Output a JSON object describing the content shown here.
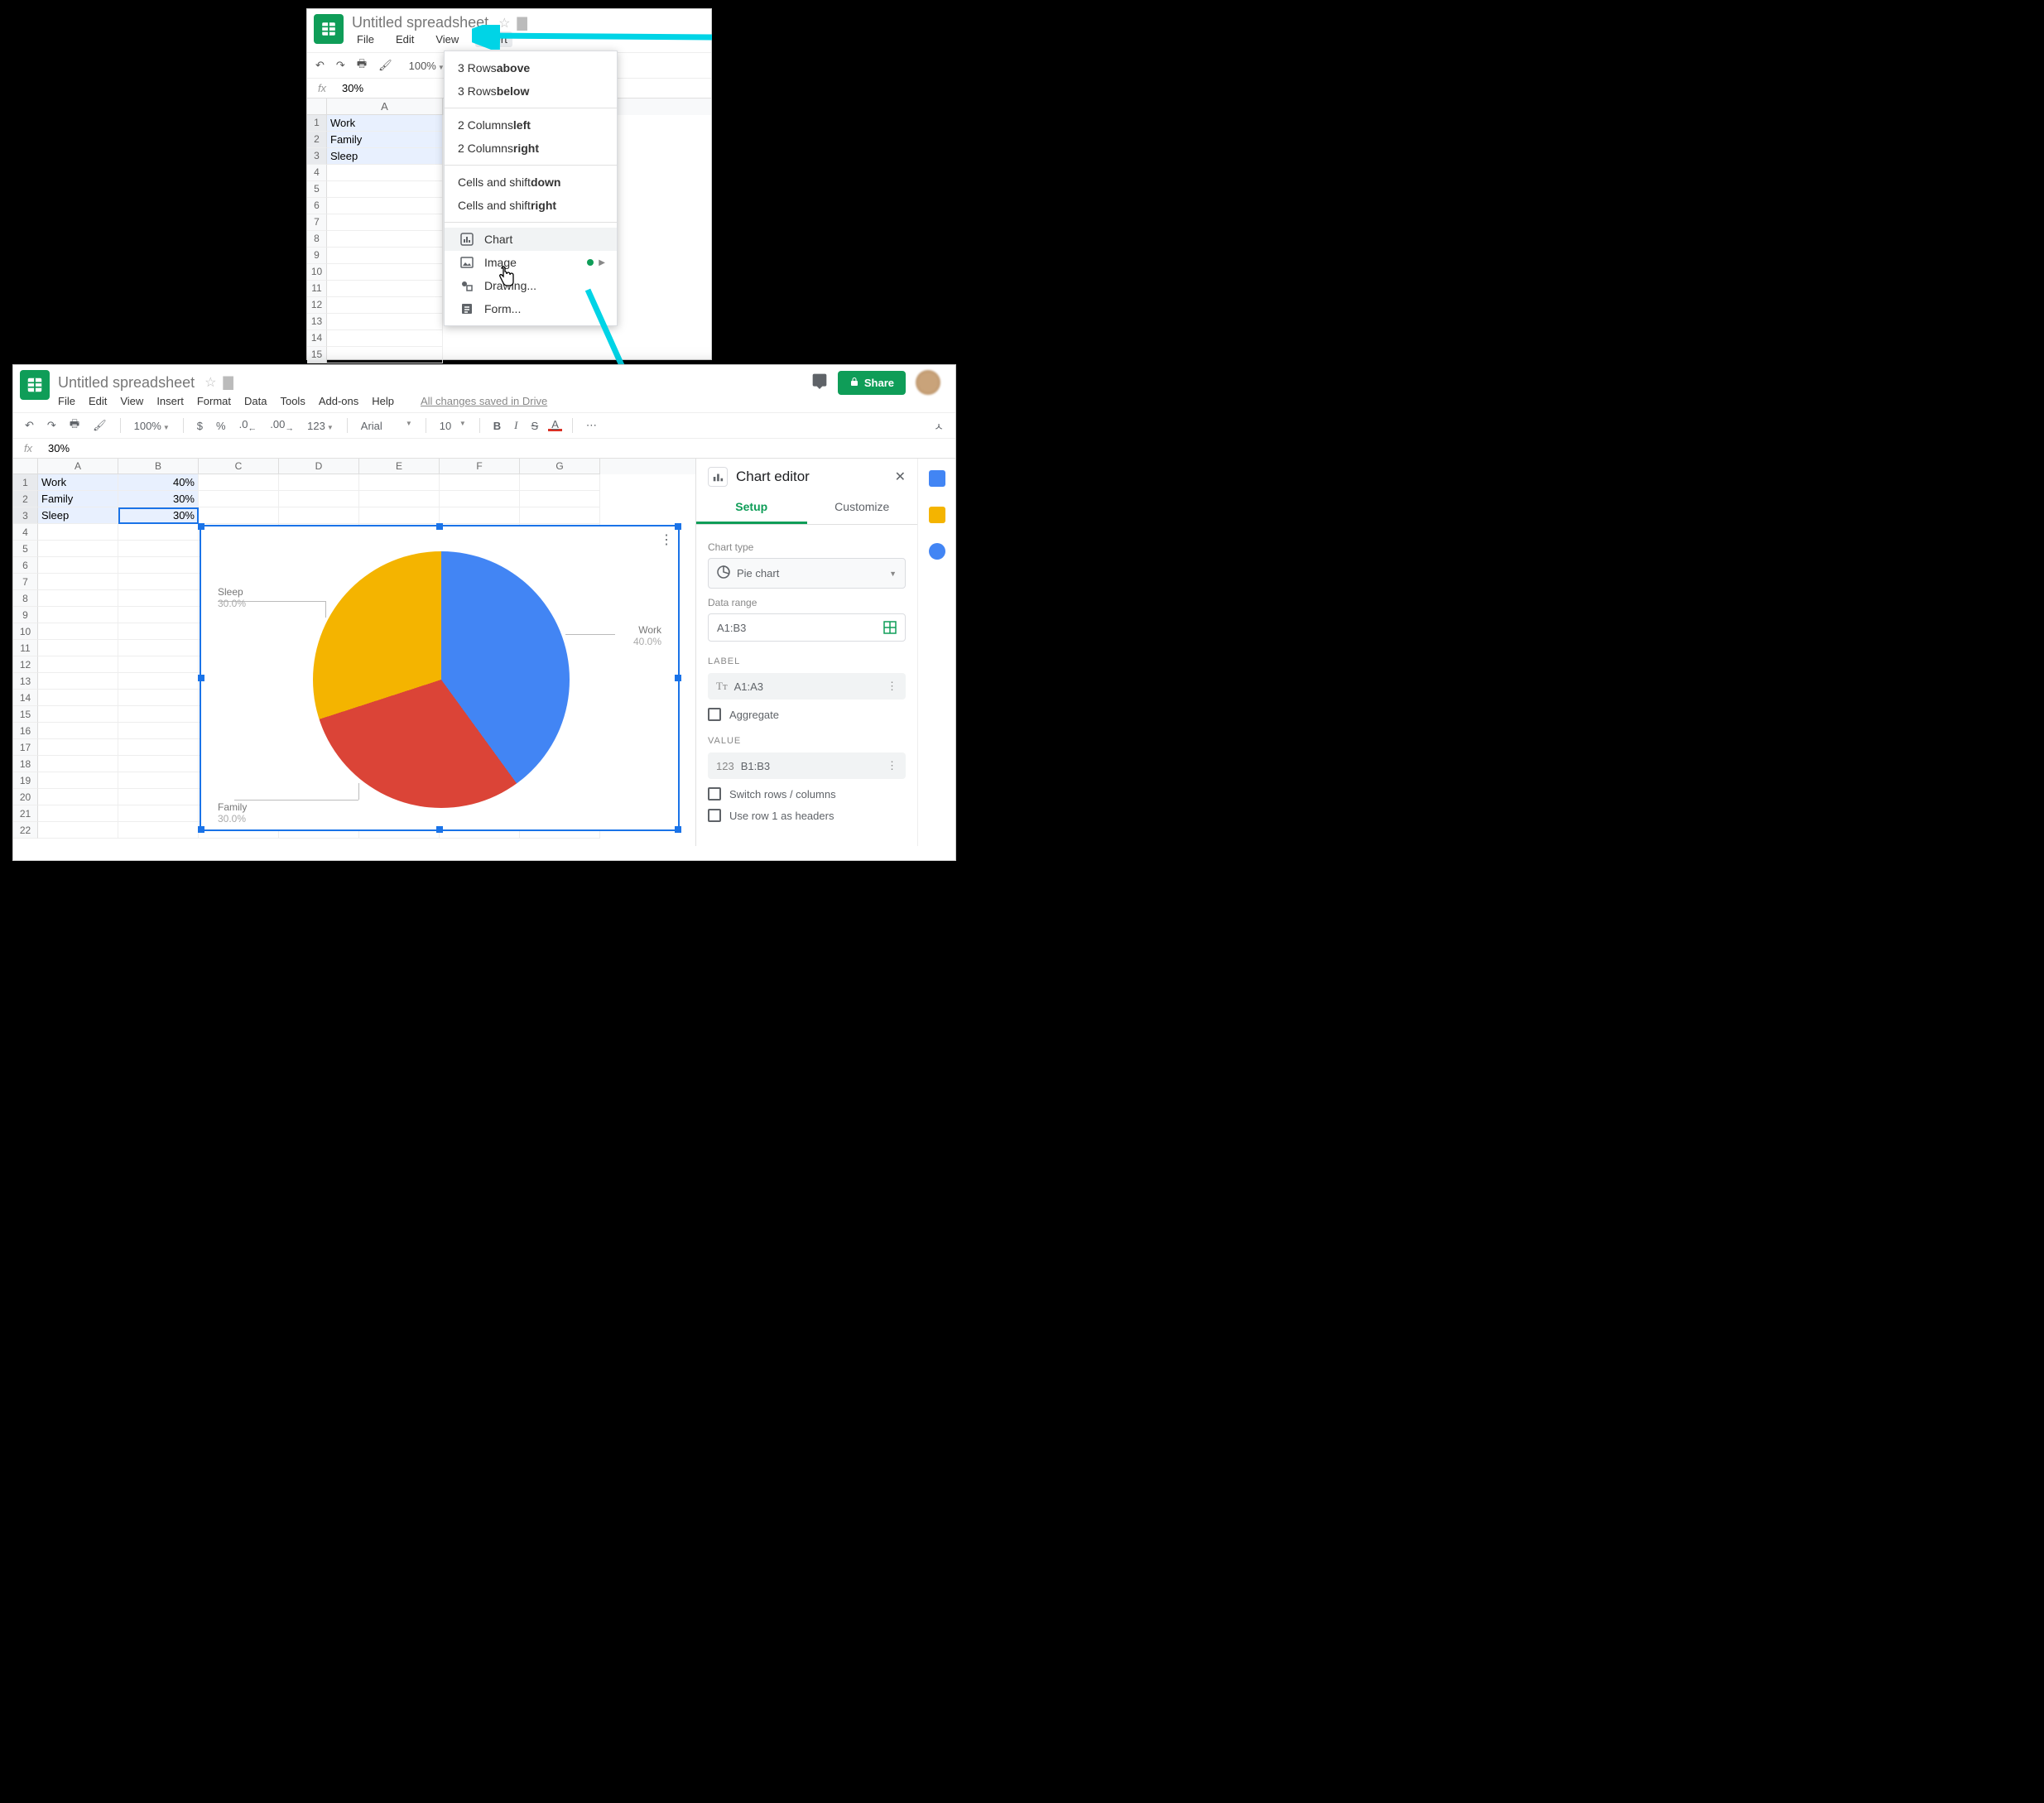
{
  "top": {
    "title": "Untitled spreadsheet",
    "menus": [
      "File",
      "Edit",
      "View",
      "Insert"
    ],
    "active_menu": "Insert",
    "zoom": "100%",
    "fx_value": "30%",
    "col_headers": [
      "A"
    ],
    "rows": [
      {
        "n": "1",
        "a": "Work"
      },
      {
        "n": "2",
        "a": "Family"
      },
      {
        "n": "3",
        "a": "Sleep"
      },
      {
        "n": "4",
        "a": ""
      },
      {
        "n": "5",
        "a": ""
      },
      {
        "n": "6",
        "a": ""
      },
      {
        "n": "7",
        "a": ""
      },
      {
        "n": "8",
        "a": ""
      },
      {
        "n": "9",
        "a": ""
      },
      {
        "n": "10",
        "a": ""
      },
      {
        "n": "11",
        "a": ""
      },
      {
        "n": "12",
        "a": ""
      },
      {
        "n": "13",
        "a": ""
      },
      {
        "n": "14",
        "a": ""
      },
      {
        "n": "15",
        "a": ""
      }
    ],
    "dropdown": {
      "rows_above": {
        "pre": "3 Rows ",
        "b": "above"
      },
      "rows_below": {
        "pre": "3 Rows ",
        "b": "below"
      },
      "cols_left": {
        "pre": "2 Columns ",
        "b": "left"
      },
      "cols_right": {
        "pre": "2 Columns ",
        "b": "right"
      },
      "cells_down": {
        "pre": "Cells and shift ",
        "b": "down"
      },
      "cells_right": {
        "pre": "Cells and shift ",
        "b": "right"
      },
      "chart": "Chart",
      "image": "Image",
      "drawing": "Drawing...",
      "form": "Form..."
    }
  },
  "bottom": {
    "title": "Untitled spreadsheet",
    "menus": [
      "File",
      "Edit",
      "View",
      "Insert",
      "Format",
      "Data",
      "Tools",
      "Add-ons",
      "Help"
    ],
    "saved_text": "All changes saved in Drive",
    "share_label": "Share",
    "zoom": "100%",
    "font_name": "Arial",
    "font_size": "10",
    "fx_value": "30%",
    "col_headers": [
      "A",
      "B",
      "C",
      "D",
      "E",
      "F",
      "G"
    ],
    "data_rows": [
      {
        "n": "1",
        "a": "Work",
        "b": "40%"
      },
      {
        "n": "2",
        "a": "Family",
        "b": "30%"
      },
      {
        "n": "3",
        "a": "Sleep",
        "b": "30%"
      }
    ],
    "empty_rows": [
      "4",
      "5",
      "6",
      "7",
      "8",
      "9",
      "10",
      "11",
      "12",
      "13",
      "14",
      "15",
      "16",
      "17",
      "18",
      "19",
      "20",
      "21",
      "22"
    ],
    "chart_labels": {
      "work": {
        "name": "Work",
        "pct": "40.0%"
      },
      "family": {
        "name": "Family",
        "pct": "30.0%"
      },
      "sleep": {
        "name": "Sleep",
        "pct": "30.0%"
      }
    },
    "editor": {
      "title": "Chart editor",
      "tab_setup": "Setup",
      "tab_customize": "Customize",
      "chart_type_label": "Chart type",
      "chart_type_value": "Pie chart",
      "data_range_label": "Data range",
      "data_range_value": "A1:B3",
      "label_section": "LABEL",
      "label_value": "A1:A3",
      "aggregate": "Aggregate",
      "value_section": "VALUE",
      "value_value": "B1:B3",
      "switch_rows": "Switch rows / columns",
      "use_row1": "Use row 1 as headers"
    }
  },
  "chart_data": {
    "type": "pie",
    "categories": [
      "Work",
      "Family",
      "Sleep"
    ],
    "values": [
      40,
      30,
      30
    ],
    "title": "",
    "colors": [
      "#4285f4",
      "#db4437",
      "#f4b400"
    ]
  }
}
